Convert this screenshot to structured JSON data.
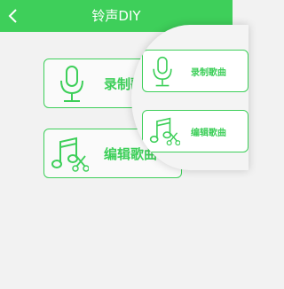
{
  "header": {
    "title": "铃声DIY",
    "back_icon": "chevron-left-icon"
  },
  "cards": {
    "record": {
      "label": "录制歌曲",
      "icon": "microphone-icon"
    },
    "edit": {
      "label": "编辑歌曲",
      "icon": "music-note-scissors-icon"
    }
  },
  "magnifier": {
    "record_label": "录制歌曲",
    "edit_label": "编辑歌曲"
  },
  "colors": {
    "accent": "#3ecf5a",
    "background": "#f2f2f2"
  }
}
